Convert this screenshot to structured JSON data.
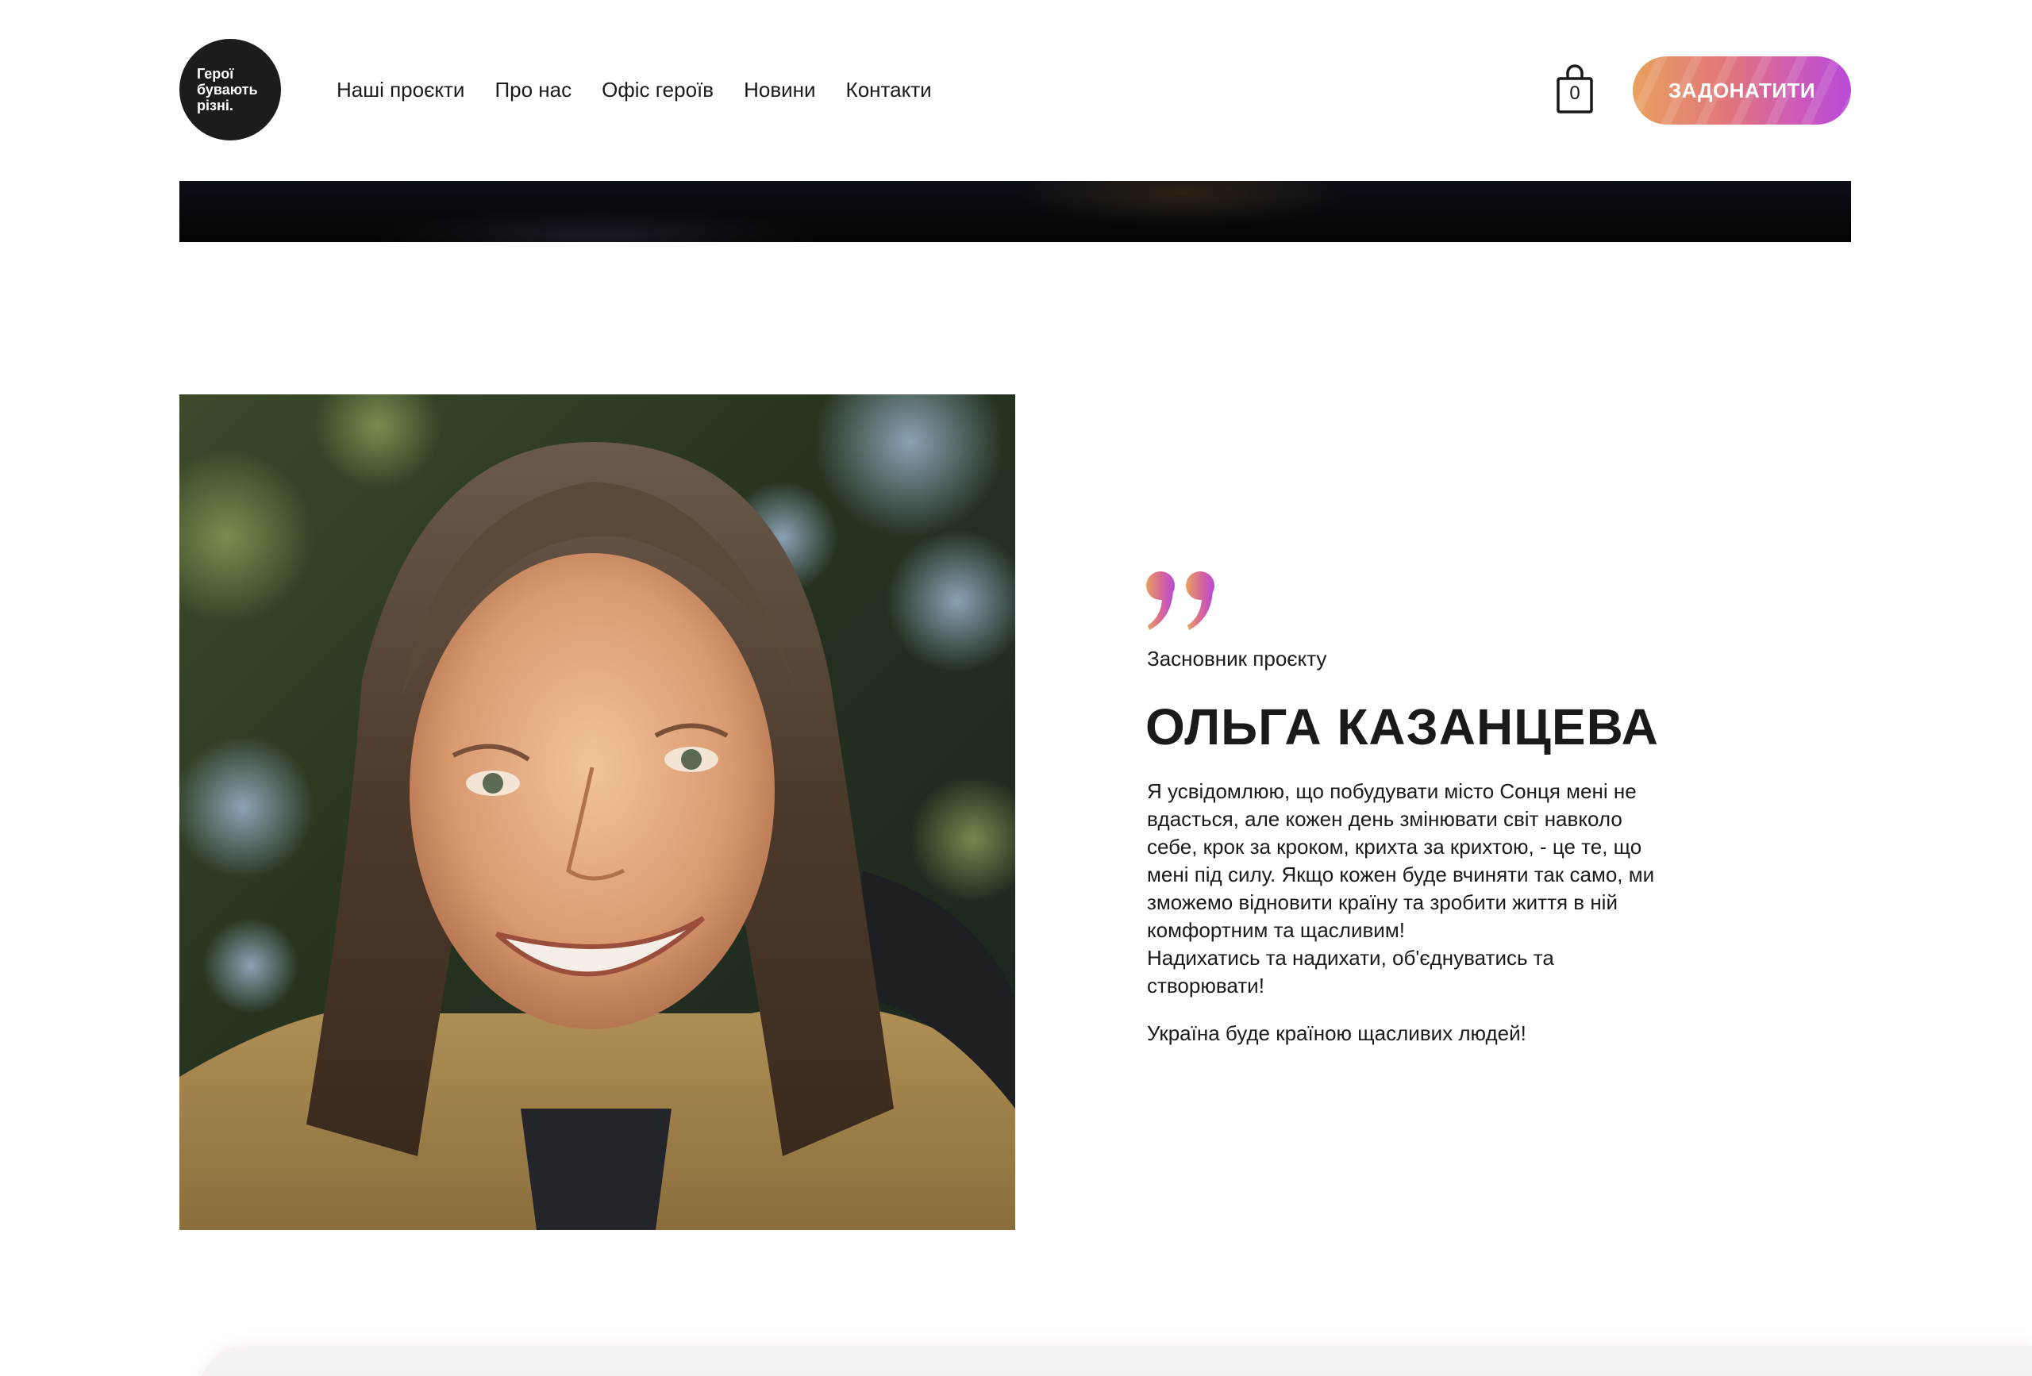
{
  "header": {
    "logo_lines": [
      "Герої",
      "бувають",
      "різні."
    ],
    "nav": [
      {
        "label": "Наші проєкти"
      },
      {
        "label": "Про нас"
      },
      {
        "label": "Офіс героїв"
      },
      {
        "label": "Новини"
      },
      {
        "label": "Контакти"
      }
    ],
    "cart_count": "0",
    "donate_label": "ЗАДОНАТИТИ"
  },
  "founder": {
    "role": "Засновник проєкту",
    "name": "ОЛЬГА КАЗАНЦЕВА",
    "bio_paragraphs": [
      "Я усвідомлюю, що побудувати місто Сонця мені не\nвдасться, але кожен день змінювати світ навколо\nсебе, крок за кроком, крихта за крихтою, -  це те, що\nмені під силу. Якщо кожен буде вчиняти так само, ми\nзможемо відновити країну та зробити життя в ній\nкомфортним та щасливим!\nНадихатись та надихати, об'єднуватись та\nстворювати!",
      "Україна буде країною щасливих людей!"
    ]
  },
  "colors": {
    "accent_orange": "#e8a160",
    "accent_purple": "#b84ad8",
    "text": "#1a1a1a",
    "logo_bg": "#1c1c1c"
  },
  "icons": {
    "cart": "shopping-bag-icon",
    "quote": "quote-mark-icon"
  }
}
